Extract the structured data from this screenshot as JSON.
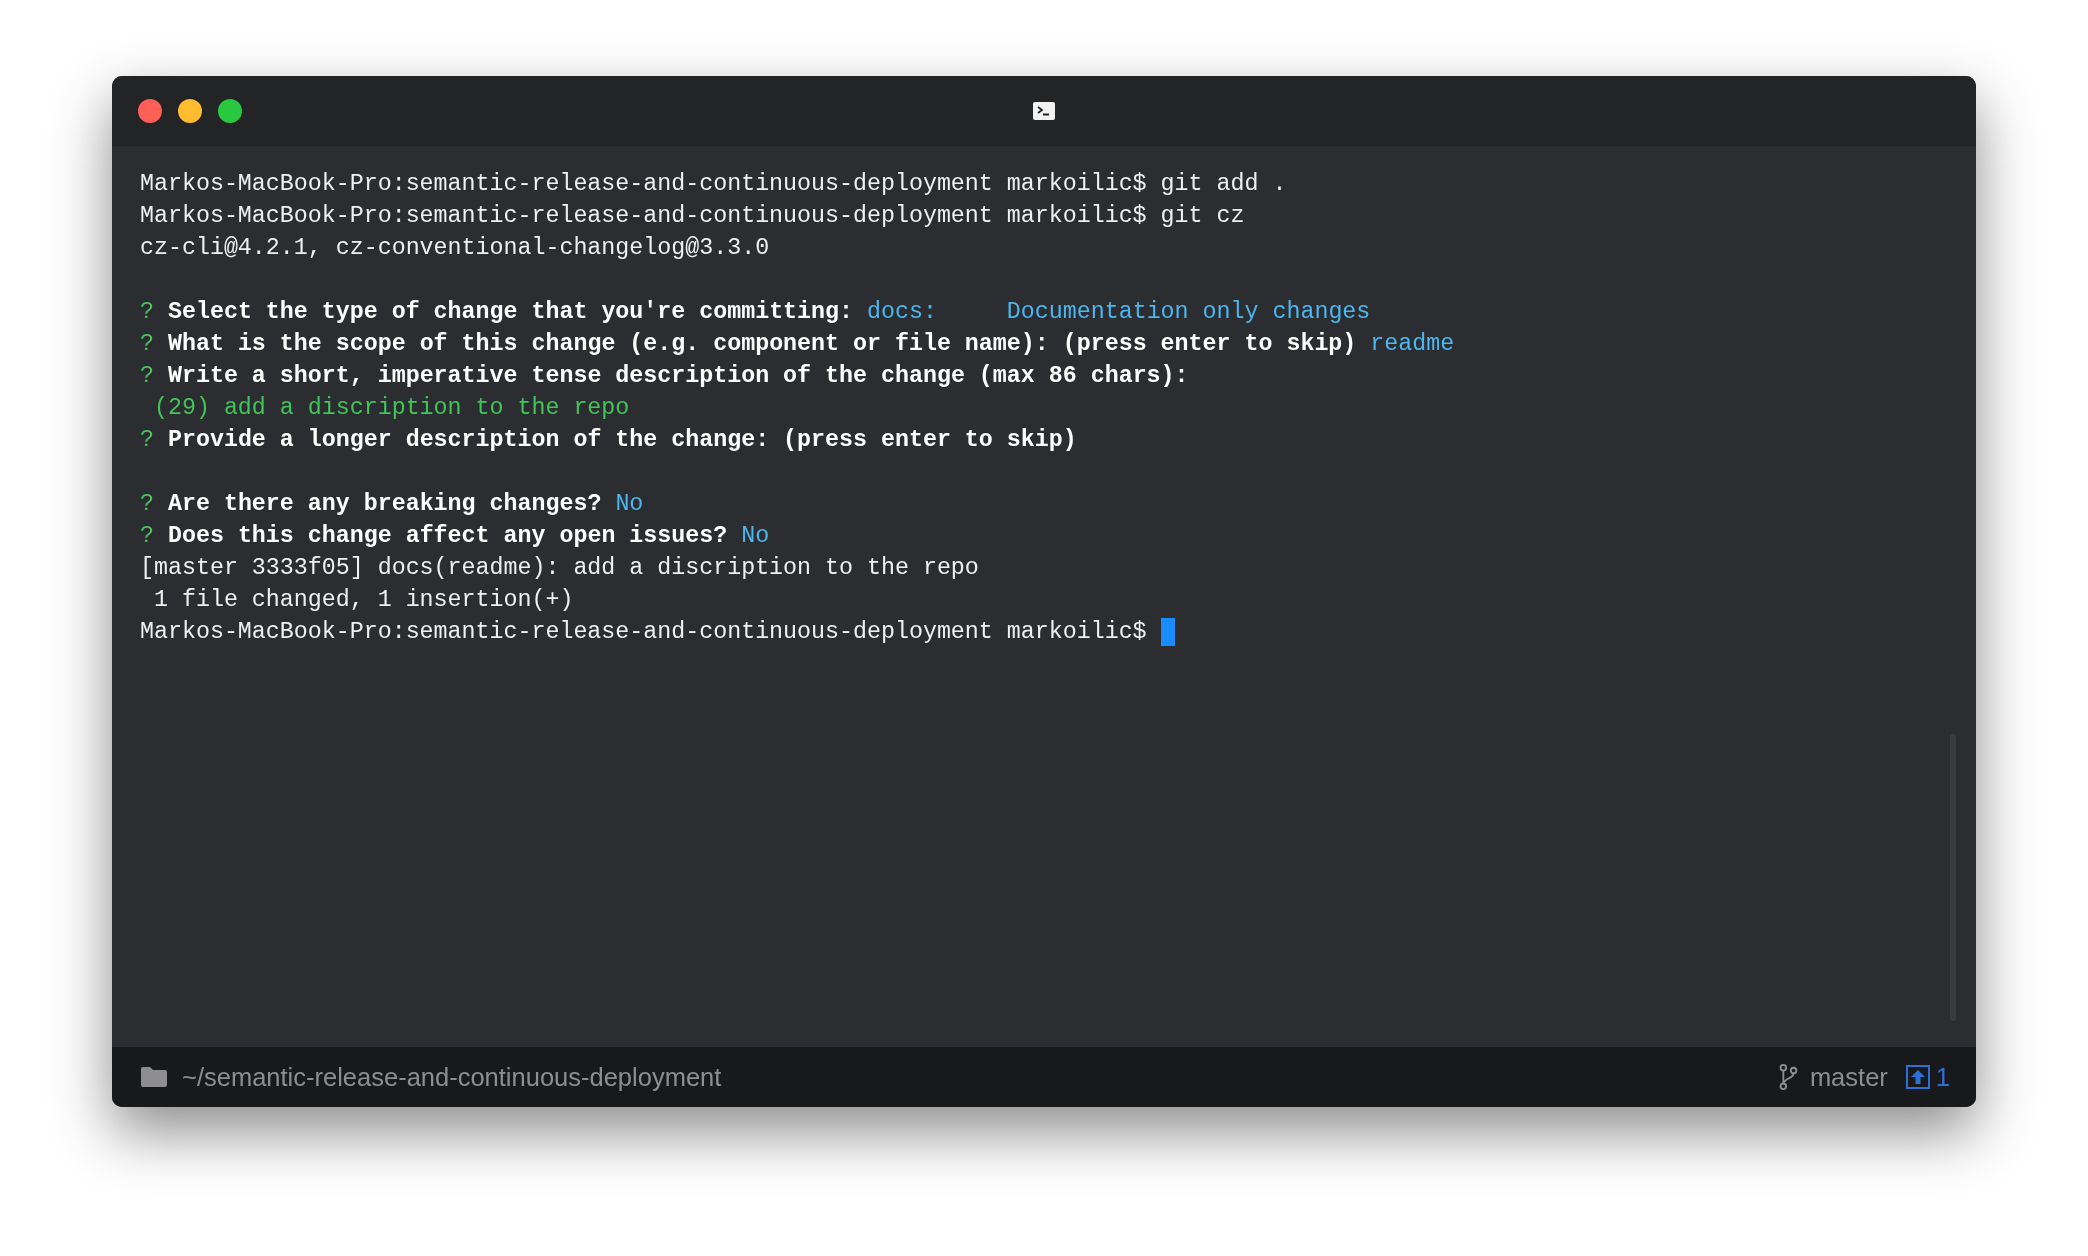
{
  "terminal": {
    "lines": [
      {
        "kind": "text",
        "segments": [
          {
            "kind": "plain",
            "text": "Markos-MacBook-Pro:semantic-release-and-continuous-deployment markoilic$ git add ."
          }
        ]
      },
      {
        "kind": "text",
        "segments": [
          {
            "kind": "plain",
            "text": "Markos-MacBook-Pro:semantic-release-and-continuous-deployment markoilic$ git cz"
          }
        ]
      },
      {
        "kind": "text",
        "segments": [
          {
            "kind": "plain",
            "text": "cz-cli@4.2.1, cz-conventional-changelog@3.3.0"
          }
        ]
      },
      {
        "kind": "blank"
      },
      {
        "kind": "text",
        "segments": [
          {
            "kind": "mark",
            "text": "?"
          },
          {
            "kind": "bold",
            "text": "Select the type of change that you're committing:"
          },
          {
            "kind": "answer",
            "text": "docs:     Documentation only changes"
          }
        ]
      },
      {
        "kind": "text",
        "segments": [
          {
            "kind": "mark",
            "text": "?"
          },
          {
            "kind": "bold",
            "text": "What is the scope of this change (e.g. component or file name): (press enter to skip)"
          },
          {
            "kind": "answer",
            "text": "readme"
          }
        ]
      },
      {
        "kind": "text",
        "segments": [
          {
            "kind": "mark",
            "text": "?"
          },
          {
            "kind": "bold",
            "text": "Write a short, imperative tense description of the change (max 86 chars):"
          }
        ]
      },
      {
        "kind": "text",
        "segments": [
          {
            "kind": "success",
            "text": " (29) add a discription to the repo"
          }
        ]
      },
      {
        "kind": "text",
        "segments": [
          {
            "kind": "mark",
            "text": "?"
          },
          {
            "kind": "bold",
            "text": "Provide a longer description of the change: (press enter to skip)"
          }
        ]
      },
      {
        "kind": "blank"
      },
      {
        "kind": "text",
        "segments": [
          {
            "kind": "mark",
            "text": "?"
          },
          {
            "kind": "bold",
            "text": "Are there any breaking changes?"
          },
          {
            "kind": "answer",
            "text": "No"
          }
        ]
      },
      {
        "kind": "text",
        "segments": [
          {
            "kind": "mark",
            "text": "?"
          },
          {
            "kind": "bold",
            "text": "Does this change affect any open issues?"
          },
          {
            "kind": "answer",
            "text": "No"
          }
        ]
      },
      {
        "kind": "text",
        "segments": [
          {
            "kind": "plain",
            "text": "[master 3333f05] docs(readme): add a discription to the repo"
          }
        ]
      },
      {
        "kind": "text",
        "segments": [
          {
            "kind": "plain",
            "text": " 1 file changed, 1 insertion(+)"
          }
        ]
      },
      {
        "kind": "text",
        "segments": [
          {
            "kind": "plain",
            "text": "Markos-MacBook-Pro:semantic-release-and-continuous-deployment markoilic$"
          }
        ],
        "cursor": true
      }
    ]
  },
  "status_bar": {
    "path": "~/semantic-release-and-continuous-deployment",
    "branch": "master",
    "ahead": "1"
  }
}
